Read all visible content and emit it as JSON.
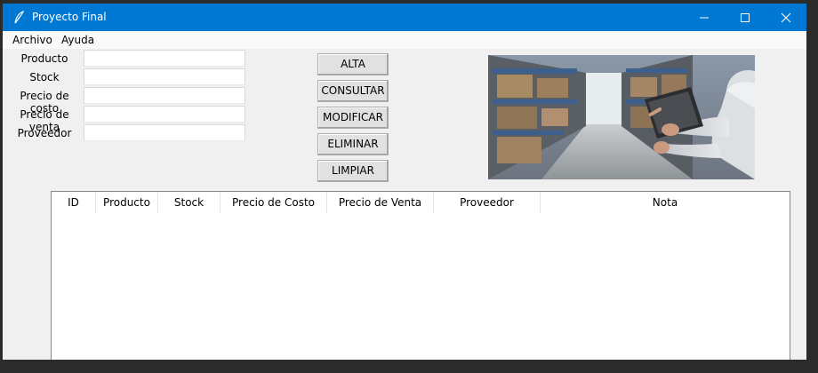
{
  "window": {
    "title": "Proyecto Final",
    "accent": "#0078d4"
  },
  "menu": {
    "items": [
      "Archivo",
      "Ayuda"
    ]
  },
  "form": {
    "fields": [
      {
        "label": "Producto",
        "value": ""
      },
      {
        "label": "Stock",
        "value": ""
      },
      {
        "label": "Precio de costo",
        "value": ""
      },
      {
        "label": "Precio de venta",
        "value": ""
      },
      {
        "label": "Proveedor",
        "value": ""
      }
    ]
  },
  "actions": [
    "ALTA",
    "CONSULTAR",
    "MODIFICAR",
    "ELIMINAR",
    "LIMPIAR"
  ],
  "image": {
    "subject": "warehouse photo with worker holding tablet"
  },
  "table": {
    "columns": [
      "ID",
      "Producto",
      "Stock",
      "Precio de Costo",
      "Precio de Venta",
      "Proveedor",
      "Nota"
    ],
    "rows": []
  },
  "icons": {
    "app": "feather-icon",
    "minimize": "minimize-icon",
    "maximize": "maximize-icon",
    "close": "close-icon"
  }
}
